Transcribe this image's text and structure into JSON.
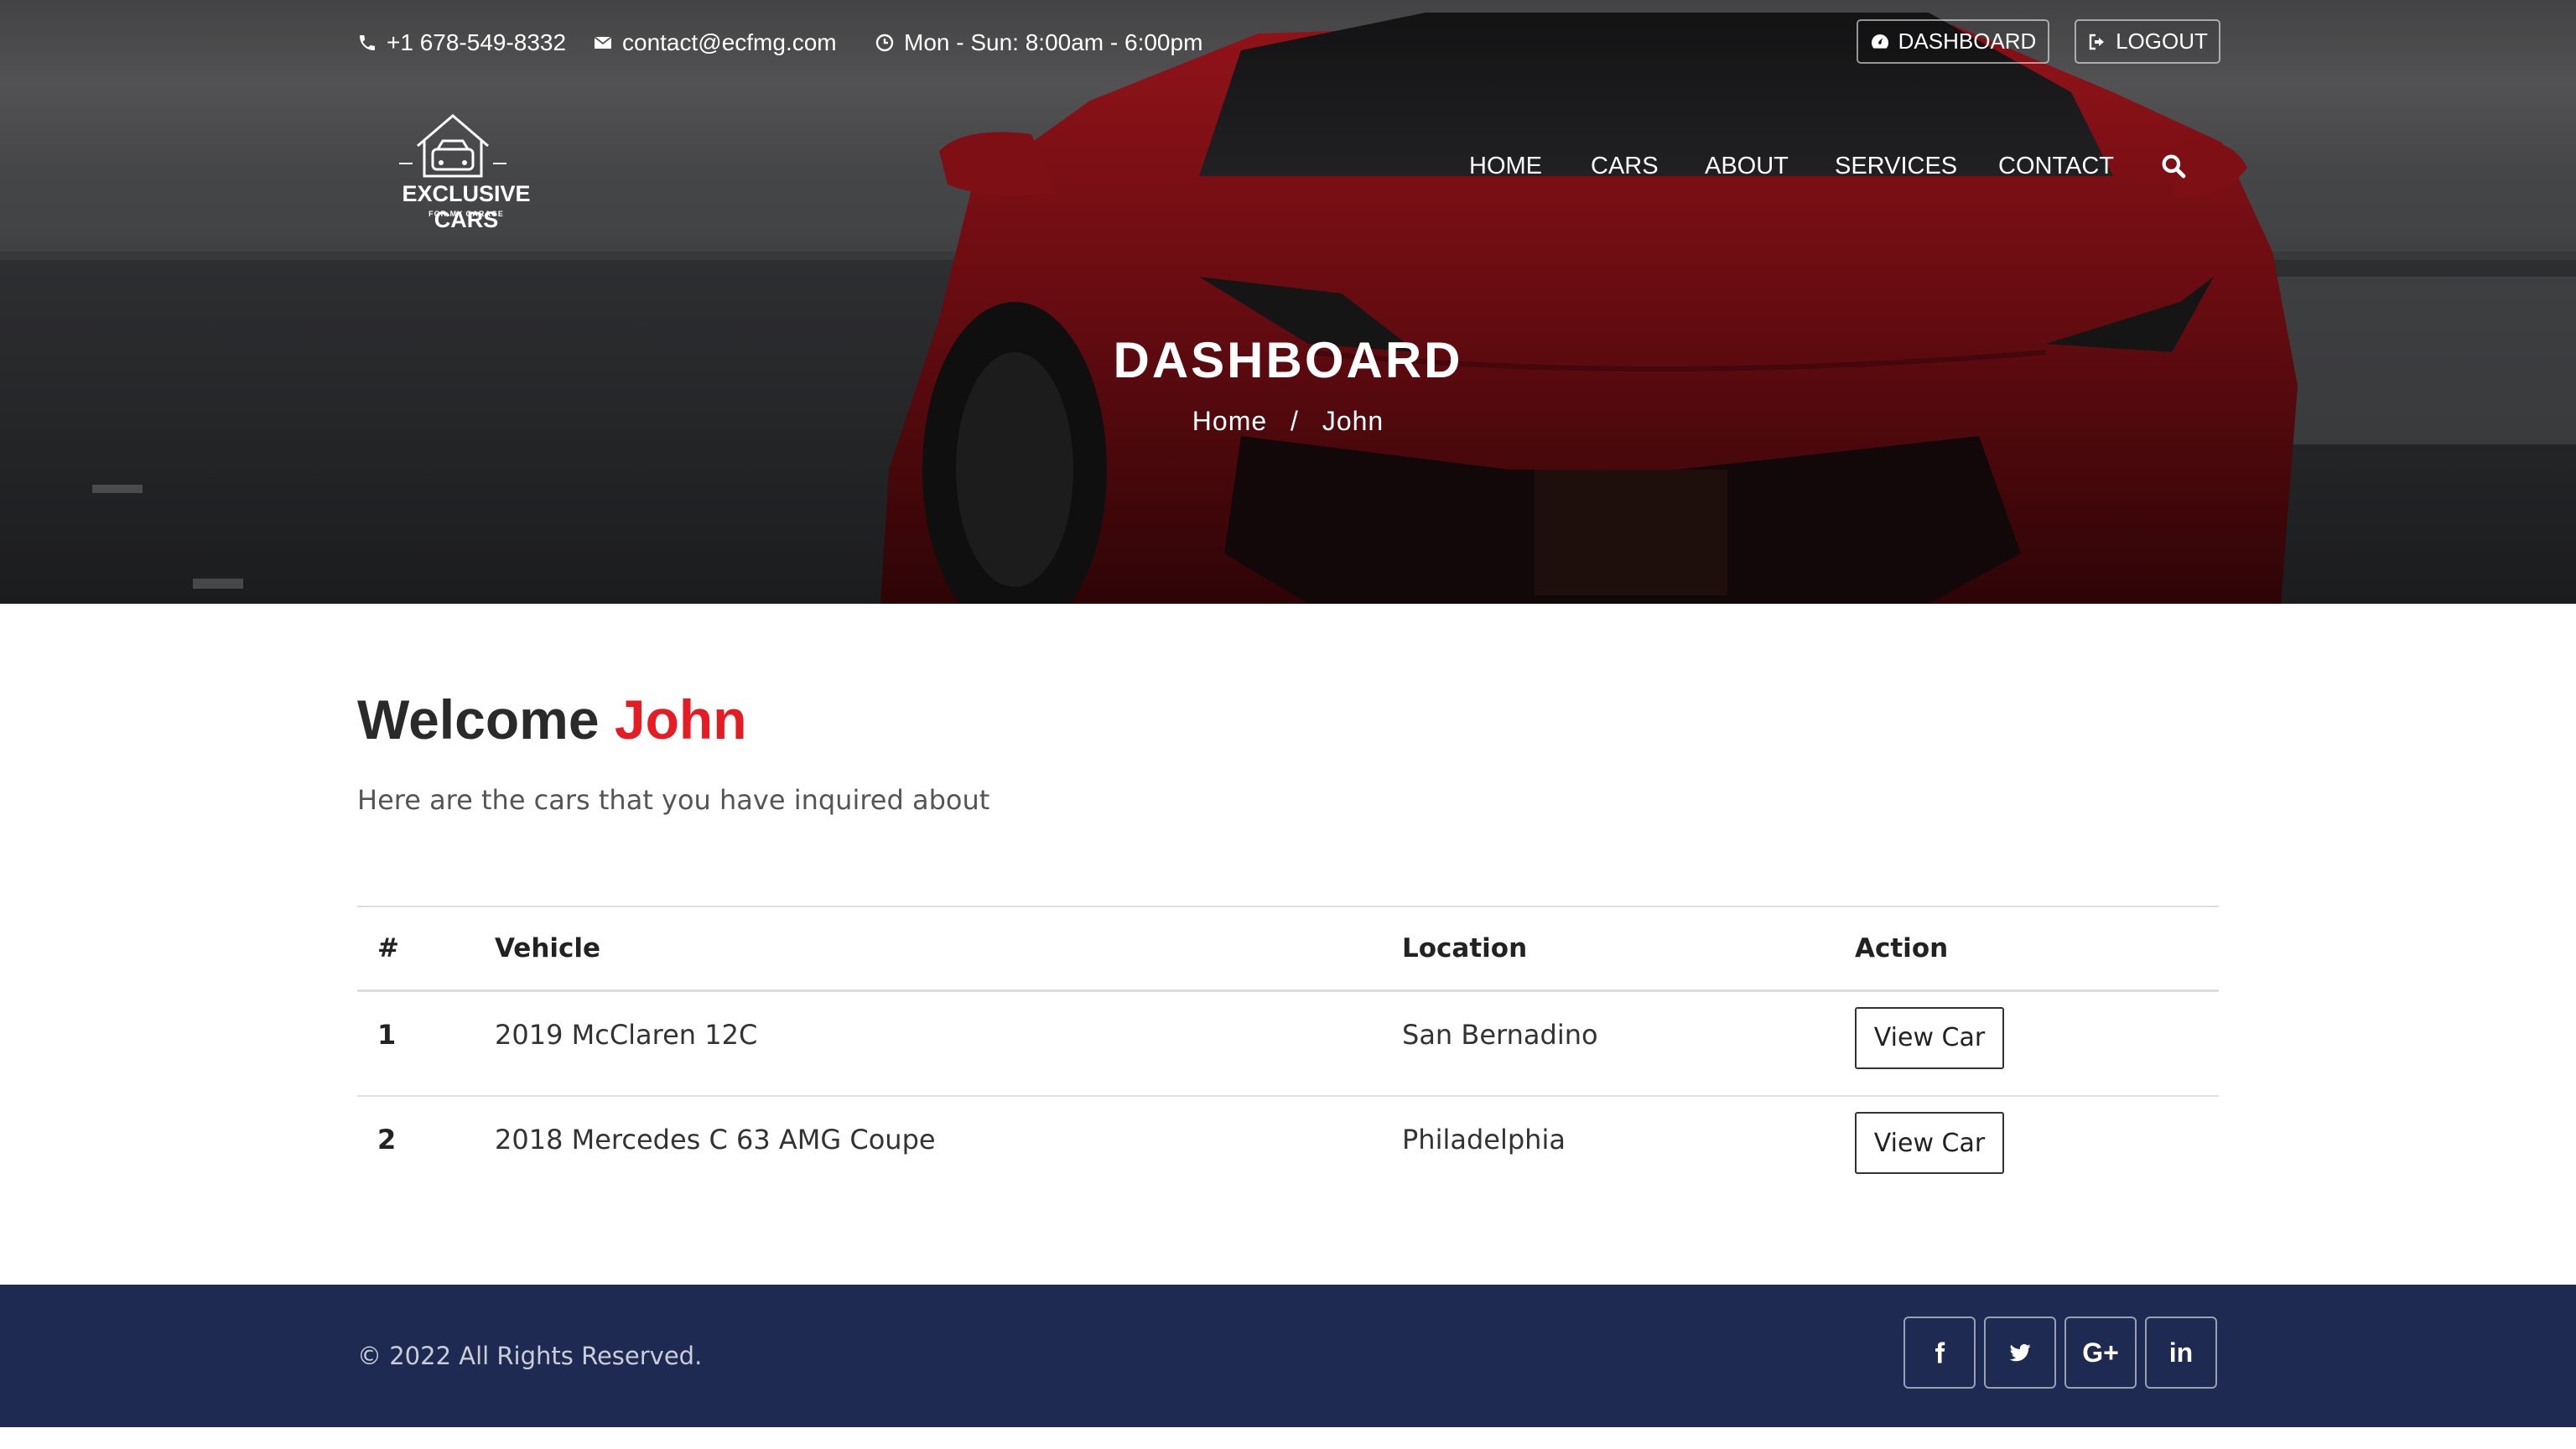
{
  "topbar": {
    "phone": "+1 678-549-8332",
    "email": "contact@ecfmg.com",
    "hours": "Mon - Sun: 8:00am - 6:00pm",
    "dashboard_label": "DASHBOARD",
    "logout_label": "LOGOUT"
  },
  "logo": {
    "name": "EXCLUSIVE CARS",
    "tagline": "FOR MY GARAGE"
  },
  "nav": {
    "items": [
      "HOME",
      "CARS",
      "ABOUT",
      "SERVICES",
      "CONTACT"
    ]
  },
  "hero": {
    "title": "DASHBOARD",
    "breadcrumb": [
      "Home",
      "John"
    ]
  },
  "main": {
    "welcome_prefix": "Welcome",
    "user_name": "John",
    "lead": "Here are the cars that you have inquired about",
    "table": {
      "headers": [
        "#",
        "Vehicle",
        "Location",
        "Action"
      ],
      "rows": [
        {
          "num": "1",
          "vehicle": "2019 McClaren 12C",
          "location": "San Bernadino",
          "action": "View Car"
        },
        {
          "num": "2",
          "vehicle": "2018 Mercedes C 63 AMG Coupe",
          "location": "Philadelphia",
          "action": "View Car"
        }
      ]
    }
  },
  "footer": {
    "copyright": "© 2022 All Rights Reserved.",
    "social": [
      "facebook-icon",
      "twitter-icon",
      "google-plus-icon",
      "linkedin-icon"
    ],
    "google_plus_label": "G+",
    "linkedin_label": "in"
  },
  "colors": {
    "accent": "#e51c23",
    "footer_bg": "#1f2a52",
    "car_red": "#8e1118"
  }
}
